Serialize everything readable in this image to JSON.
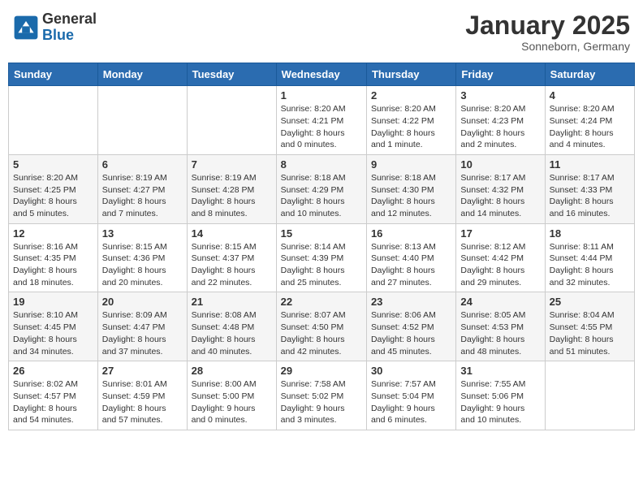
{
  "header": {
    "logo_general": "General",
    "logo_blue": "Blue",
    "month_title": "January 2025",
    "location": "Sonneborn, Germany"
  },
  "days_of_week": [
    "Sunday",
    "Monday",
    "Tuesday",
    "Wednesday",
    "Thursday",
    "Friday",
    "Saturday"
  ],
  "weeks": [
    [
      {
        "day": "",
        "info": ""
      },
      {
        "day": "",
        "info": ""
      },
      {
        "day": "",
        "info": ""
      },
      {
        "day": "1",
        "info": "Sunrise: 8:20 AM\nSunset: 4:21 PM\nDaylight: 8 hours\nand 0 minutes."
      },
      {
        "day": "2",
        "info": "Sunrise: 8:20 AM\nSunset: 4:22 PM\nDaylight: 8 hours\nand 1 minute."
      },
      {
        "day": "3",
        "info": "Sunrise: 8:20 AM\nSunset: 4:23 PM\nDaylight: 8 hours\nand 2 minutes."
      },
      {
        "day": "4",
        "info": "Sunrise: 8:20 AM\nSunset: 4:24 PM\nDaylight: 8 hours\nand 4 minutes."
      }
    ],
    [
      {
        "day": "5",
        "info": "Sunrise: 8:20 AM\nSunset: 4:25 PM\nDaylight: 8 hours\nand 5 minutes."
      },
      {
        "day": "6",
        "info": "Sunrise: 8:19 AM\nSunset: 4:27 PM\nDaylight: 8 hours\nand 7 minutes."
      },
      {
        "day": "7",
        "info": "Sunrise: 8:19 AM\nSunset: 4:28 PM\nDaylight: 8 hours\nand 8 minutes."
      },
      {
        "day": "8",
        "info": "Sunrise: 8:18 AM\nSunset: 4:29 PM\nDaylight: 8 hours\nand 10 minutes."
      },
      {
        "day": "9",
        "info": "Sunrise: 8:18 AM\nSunset: 4:30 PM\nDaylight: 8 hours\nand 12 minutes."
      },
      {
        "day": "10",
        "info": "Sunrise: 8:17 AM\nSunset: 4:32 PM\nDaylight: 8 hours\nand 14 minutes."
      },
      {
        "day": "11",
        "info": "Sunrise: 8:17 AM\nSunset: 4:33 PM\nDaylight: 8 hours\nand 16 minutes."
      }
    ],
    [
      {
        "day": "12",
        "info": "Sunrise: 8:16 AM\nSunset: 4:35 PM\nDaylight: 8 hours\nand 18 minutes."
      },
      {
        "day": "13",
        "info": "Sunrise: 8:15 AM\nSunset: 4:36 PM\nDaylight: 8 hours\nand 20 minutes."
      },
      {
        "day": "14",
        "info": "Sunrise: 8:15 AM\nSunset: 4:37 PM\nDaylight: 8 hours\nand 22 minutes."
      },
      {
        "day": "15",
        "info": "Sunrise: 8:14 AM\nSunset: 4:39 PM\nDaylight: 8 hours\nand 25 minutes."
      },
      {
        "day": "16",
        "info": "Sunrise: 8:13 AM\nSunset: 4:40 PM\nDaylight: 8 hours\nand 27 minutes."
      },
      {
        "day": "17",
        "info": "Sunrise: 8:12 AM\nSunset: 4:42 PM\nDaylight: 8 hours\nand 29 minutes."
      },
      {
        "day": "18",
        "info": "Sunrise: 8:11 AM\nSunset: 4:44 PM\nDaylight: 8 hours\nand 32 minutes."
      }
    ],
    [
      {
        "day": "19",
        "info": "Sunrise: 8:10 AM\nSunset: 4:45 PM\nDaylight: 8 hours\nand 34 minutes."
      },
      {
        "day": "20",
        "info": "Sunrise: 8:09 AM\nSunset: 4:47 PM\nDaylight: 8 hours\nand 37 minutes."
      },
      {
        "day": "21",
        "info": "Sunrise: 8:08 AM\nSunset: 4:48 PM\nDaylight: 8 hours\nand 40 minutes."
      },
      {
        "day": "22",
        "info": "Sunrise: 8:07 AM\nSunset: 4:50 PM\nDaylight: 8 hours\nand 42 minutes."
      },
      {
        "day": "23",
        "info": "Sunrise: 8:06 AM\nSunset: 4:52 PM\nDaylight: 8 hours\nand 45 minutes."
      },
      {
        "day": "24",
        "info": "Sunrise: 8:05 AM\nSunset: 4:53 PM\nDaylight: 8 hours\nand 48 minutes."
      },
      {
        "day": "25",
        "info": "Sunrise: 8:04 AM\nSunset: 4:55 PM\nDaylight: 8 hours\nand 51 minutes."
      }
    ],
    [
      {
        "day": "26",
        "info": "Sunrise: 8:02 AM\nSunset: 4:57 PM\nDaylight: 8 hours\nand 54 minutes."
      },
      {
        "day": "27",
        "info": "Sunrise: 8:01 AM\nSunset: 4:59 PM\nDaylight: 8 hours\nand 57 minutes."
      },
      {
        "day": "28",
        "info": "Sunrise: 8:00 AM\nSunset: 5:00 PM\nDaylight: 9 hours\nand 0 minutes."
      },
      {
        "day": "29",
        "info": "Sunrise: 7:58 AM\nSunset: 5:02 PM\nDaylight: 9 hours\nand 3 minutes."
      },
      {
        "day": "30",
        "info": "Sunrise: 7:57 AM\nSunset: 5:04 PM\nDaylight: 9 hours\nand 6 minutes."
      },
      {
        "day": "31",
        "info": "Sunrise: 7:55 AM\nSunset: 5:06 PM\nDaylight: 9 hours\nand 10 minutes."
      },
      {
        "day": "",
        "info": ""
      }
    ]
  ]
}
